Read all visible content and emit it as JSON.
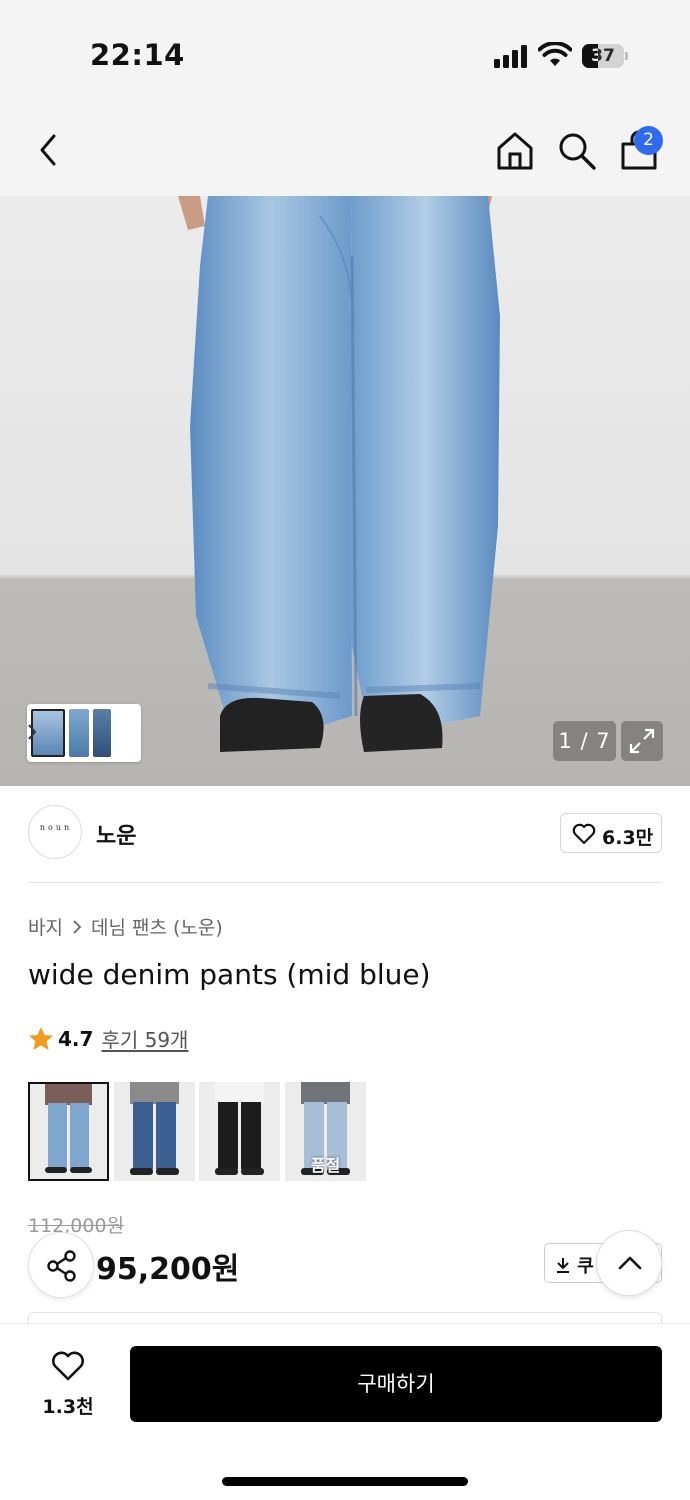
{
  "status_bar": {
    "time": "22:14",
    "battery": "37",
    "battery_level": 0.37
  },
  "nav": {
    "cart_count": "2",
    "icons": [
      "back-arrow",
      "home",
      "search",
      "shopping-bag"
    ]
  },
  "gallery": {
    "counter": "1 / 7"
  },
  "brand": {
    "logo_text": "noun",
    "name": "노운",
    "likes": "6.3만"
  },
  "breadcrumb": [
    "바지",
    "데님 팬츠 (노운)"
  ],
  "product": {
    "title": "wide denim pants (mid blue)",
    "rating": "4.7",
    "reviews": "후기 59개",
    "color_options": [
      {
        "selected": true,
        "sold_out": false,
        "color": "#7fa6cc"
      },
      {
        "selected": false,
        "sold_out": false,
        "color": "#3a5f90"
      },
      {
        "selected": false,
        "sold_out": false,
        "color": "#1c1c1c"
      },
      {
        "selected": false,
        "sold_out": true,
        "color": "#a7bed6",
        "label": "품절"
      }
    ],
    "original_price": "112,000원",
    "sale_price": "95,200원",
    "coupon": "쿠"
  },
  "bottom_bar": {
    "wish_count": "1.3천",
    "buy_label": "구매하기"
  },
  "colors": {
    "badge": "#2f6bf0",
    "star": "#f39b1a",
    "buy_button": "#000000"
  }
}
